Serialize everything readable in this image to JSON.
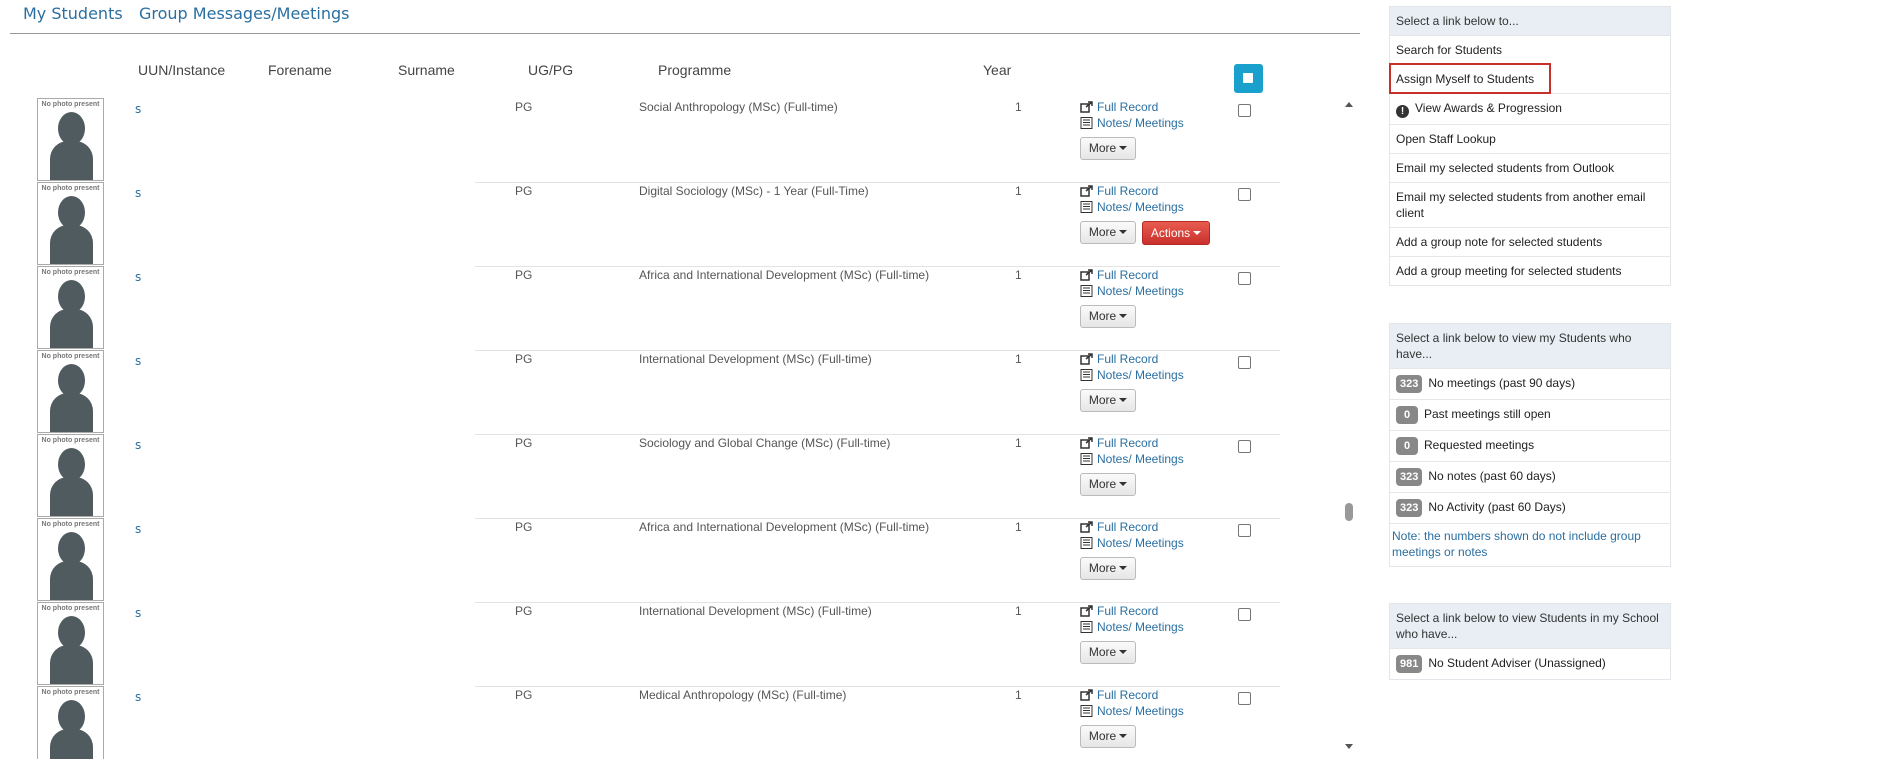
{
  "tabs": [
    "My Students",
    "Group Messages/Meetings"
  ],
  "columns": {
    "uun": "UUN/Instance",
    "forename": "Forename",
    "surname": "Surname",
    "level": "UG/PG",
    "programme": "Programme",
    "year": "Year"
  },
  "photo_placeholder": "No photo present",
  "row_actions": {
    "full_record": "Full Record",
    "notes_meetings": "Notes/ Meetings",
    "more": "More",
    "actions": "Actions"
  },
  "rows": [
    {
      "uun": "s",
      "level": "PG",
      "programme": "Social Anthropology (MSc) (Full-time)",
      "year": "1"
    },
    {
      "uun": "s",
      "level": "PG",
      "programme": "Digital Sociology (MSc) - 1 Year (Full-Time)",
      "year": "1",
      "has_actions": true
    },
    {
      "uun": "s",
      "level": "PG",
      "programme": "Africa and International Development (MSc) (Full-time)",
      "year": "1"
    },
    {
      "uun": "s",
      "level": "PG",
      "programme": "International Development (MSc) (Full-time)",
      "year": "1"
    },
    {
      "uun": "s",
      "level": "PG",
      "programme": "Sociology and Global Change (MSc) (Full-time)",
      "year": "1"
    },
    {
      "uun": "s",
      "level": "PG",
      "programme": "Africa and International Development (MSc) (Full-time)",
      "year": "1"
    },
    {
      "uun": "s",
      "level": "PG",
      "programme": "International Development (MSc) (Full-time)",
      "year": "1"
    },
    {
      "uun": "s",
      "level": "PG",
      "programme": "Medical Anthropology (MSc) (Full-time)",
      "year": "1"
    }
  ],
  "panel1": {
    "heading": "Select a link below to...",
    "items": [
      "Search for Students",
      "Assign Myself to Students",
      "View Awards & Progression",
      "Open Staff Lookup",
      "Email my selected students from Outlook",
      "Email my selected students from another email client",
      "Add a group note for selected students",
      "Add a group meeting for selected students"
    ]
  },
  "panel2": {
    "heading": "Select a link below to view my Students who have...",
    "items": [
      {
        "count": "323",
        "label": "No meetings (past 90 days)"
      },
      {
        "count": "0",
        "label": "Past meetings still open"
      },
      {
        "count": "0",
        "label": "Requested meetings"
      },
      {
        "count": "323",
        "label": "No notes (past 60 days)"
      },
      {
        "count": "323",
        "label": "No Activity (past 60 Days)"
      }
    ],
    "note": "Note: the numbers shown do not include group meetings or notes"
  },
  "panel3": {
    "heading": "Select a link below to view Students in my School who have...",
    "items": [
      {
        "count": "981",
        "label": "No Student Adviser (Unassigned)"
      }
    ]
  },
  "colors": {
    "link": "#2a6fa1",
    "select_all": "#1aa0cc",
    "actions_button": "#c9302c",
    "highlight": "#c9302c"
  }
}
